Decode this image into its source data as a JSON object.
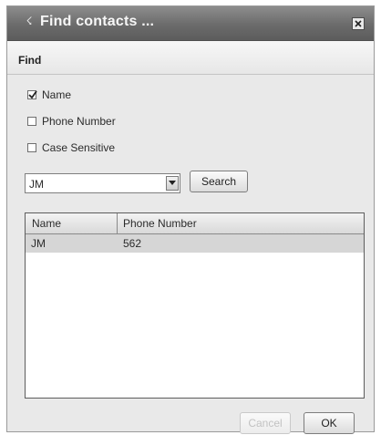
{
  "dialog": {
    "title": "Find contacts ...",
    "section_title": "Find"
  },
  "options": [
    {
      "label": "Name",
      "checked": true
    },
    {
      "label": "Phone Number",
      "checked": false
    },
    {
      "label": "Case Sensitive",
      "checked": false
    }
  ],
  "search": {
    "value": "JM",
    "button_label": "Search"
  },
  "table": {
    "columns": [
      "Name",
      "Phone Number"
    ],
    "rows": [
      {
        "name": "JM",
        "phone": "562"
      }
    ]
  },
  "footer": {
    "cancel_label": "Cancel",
    "ok_label": "OK"
  },
  "icons": {
    "title": "find-icon",
    "close": "close-icon",
    "dropdown": "chevron-down-icon",
    "check": "checkmark-icon"
  },
  "colors": {
    "titlebar": "#6b6b6b",
    "dialog_bg": "#e9e9e9",
    "selected_row": "#d6d6d6"
  }
}
